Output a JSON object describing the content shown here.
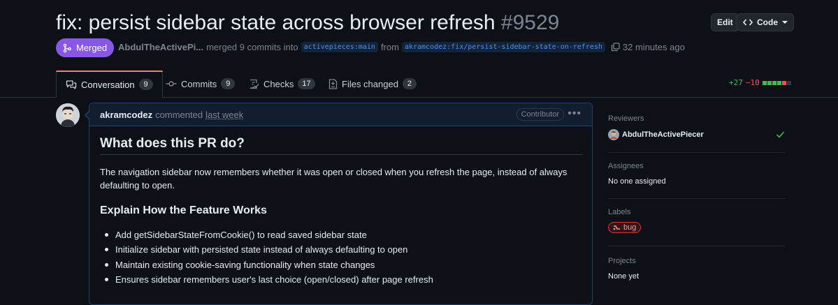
{
  "pr": {
    "title": "fix: persist sidebar state across browser refresh",
    "number": "#9529",
    "status": "Merged",
    "author": "AbdulTheActivePi...",
    "merge_text": "merged 9 commits into",
    "base_branch": "activepieces:main",
    "from_text": "from",
    "head_branch": "akramcodez:fix/persist-sidebar-state-on-refresh",
    "time_ago": "32 minutes ago"
  },
  "header_buttons": {
    "edit": "Edit",
    "code": "Code"
  },
  "tabs": [
    {
      "label": "Conversation",
      "count": "9"
    },
    {
      "label": "Commits",
      "count": "9"
    },
    {
      "label": "Checks",
      "count": "17"
    },
    {
      "label": "Files changed",
      "count": "2"
    }
  ],
  "diffstat": {
    "additions": "+27",
    "deletions": "−10",
    "colors": [
      "#3fb950",
      "#3fb950",
      "#3fb950",
      "#3fb950",
      "#f85149"
    ]
  },
  "comment": {
    "author": "akramcodez",
    "verb": "commented",
    "when": "last week",
    "badge": "Contributor",
    "h2": "What does this PR do?",
    "paragraph": "The navigation sidebar now remembers whether it was open or closed when you refresh the page, instead of always defaulting to open.",
    "h3": "Explain How the Feature Works",
    "bullets": [
      "Add getSidebarStateFromCookie() to read saved sidebar state",
      "Initialize sidebar with persisted state instead of always defaulting to open",
      "Maintain existing cookie-saving functionality when state changes",
      "Ensures sidebar remembers user's last choice (open/closed) after page refresh"
    ]
  },
  "sidebar": {
    "reviewers_label": "Reviewers",
    "reviewer": "AbdulTheActivePiecer",
    "assignees_label": "Assignees",
    "assignees_value": "No one assigned",
    "labels_label": "Labels",
    "label_bug": "bug",
    "projects_label": "Projects",
    "projects_value": "None yet"
  },
  "colors": {
    "accent_merged": "#8957e5",
    "link": "#4493f8",
    "tab_indicator": "#f78166",
    "approved_check": "#3fb950"
  }
}
